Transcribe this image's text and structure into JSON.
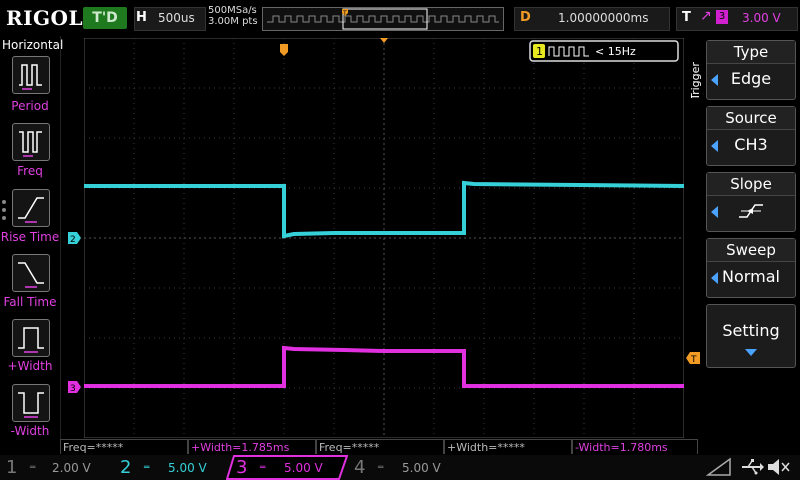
{
  "brand": "RIGOL",
  "run_state": "T'D",
  "horizontal": {
    "label": "H",
    "timebase": "500us",
    "sample_rate": "500MSa/s",
    "memory_depth": "3.00M pts"
  },
  "delay": {
    "label": "D",
    "value": "1.00000000ms"
  },
  "trigger_status": {
    "label": "T",
    "channel": "3",
    "level": "3.00 V"
  },
  "left_menu": {
    "title": "Horizontal",
    "items": [
      {
        "label": "Period",
        "icon": "period-icon"
      },
      {
        "label": "Freq",
        "icon": "frequency-icon"
      },
      {
        "label": "Rise Time",
        "icon": "rise-time-icon"
      },
      {
        "label": "Fall Time",
        "icon": "fall-time-icon"
      },
      {
        "label": "+Width",
        "icon": "positive-width-icon"
      },
      {
        "label": "-Width",
        "icon": "negative-width-icon"
      }
    ]
  },
  "freq_counter": {
    "channel": "1",
    "value": "< 15Hz"
  },
  "trigger_menu": {
    "side_title": "Trigger",
    "type": {
      "label": "Type",
      "value": "Edge"
    },
    "source": {
      "label": "Source",
      "value": "CH3"
    },
    "slope": {
      "label": "Slope"
    },
    "sweep": {
      "label": "Sweep",
      "value": "Normal"
    },
    "setting": {
      "label": "Setting"
    }
  },
  "measurements": [
    "Freq=*****",
    "+Width=1.785ms",
    "Freq=*****",
    "+Width=*****",
    "-Width=1.780ms"
  ],
  "channels": [
    {
      "num": "1",
      "scale": "2.00 V",
      "color": "#9a9a9a",
      "active": false
    },
    {
      "num": "2",
      "scale": "5.00 V",
      "color": "#35d0d8",
      "active": true
    },
    {
      "num": "3",
      "scale": "5.00 V",
      "color": "#e030e0",
      "active": true,
      "selected": true
    },
    {
      "num": "4",
      "scale": "5.00 V",
      "color": "#9a9a9a",
      "active": false
    }
  ],
  "colors": {
    "ch2": "#35d0d8",
    "ch3": "#e030e0",
    "trigger": "#f29b24",
    "grid": "#3a3a3a"
  }
}
